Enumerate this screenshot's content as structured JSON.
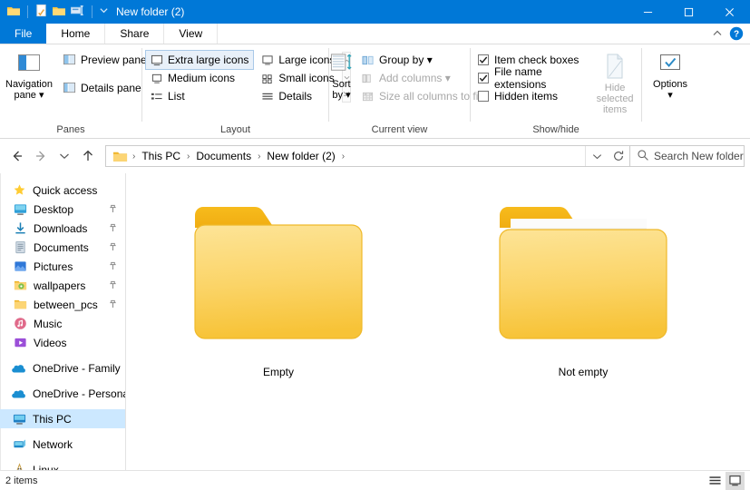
{
  "window": {
    "title": "New folder (2)",
    "titlebar_color": "#0078d7",
    "quick_access_icons": [
      "folder-icon",
      "properties-icon",
      "new-folder-icon",
      "rename-icon",
      "customize-chevron-icon"
    ],
    "minimize_label": "─",
    "maximize_label": "□",
    "close_label": "✕"
  },
  "ribbon": {
    "tabs": [
      {
        "label": "File",
        "kind": "file"
      },
      {
        "label": "Home",
        "kind": "normal"
      },
      {
        "label": "Share",
        "kind": "normal"
      },
      {
        "label": "View",
        "kind": "active"
      }
    ],
    "collapse_icon": "chevron-up-icon",
    "help_icon": "help-circle-icon",
    "help_label": "?",
    "groups": {
      "panes": {
        "label": "Panes",
        "navigation_pane": {
          "label": "Navigation\npane ▾",
          "line1": "Navigation",
          "line2": "pane ▾"
        },
        "items": [
          {
            "label": "Preview pane",
            "icon": "preview-pane-icon"
          },
          {
            "label": "Details pane",
            "icon": "details-pane-icon"
          }
        ]
      },
      "layout": {
        "label": "Layout",
        "items": [
          {
            "label": "Extra large icons",
            "icon": "monitor-icon",
            "selected": true
          },
          {
            "label": "Large icons",
            "icon": "monitor-icon",
            "selected": false
          },
          {
            "label": "Medium icons",
            "icon": "monitor-small-icon",
            "selected": false
          },
          {
            "label": "Small icons",
            "icon": "grid-small-icon",
            "selected": false
          },
          {
            "label": "List",
            "icon": "list-icon",
            "selected": false
          },
          {
            "label": "Details",
            "icon": "details-lines-icon",
            "selected": false
          }
        ],
        "scroll_up_icon": "scroll-up-icon",
        "scroll_down_icon": "scroll-down-icon",
        "scroll_more_icon": "scroll-expand-icon"
      },
      "current_view": {
        "label": "Current view",
        "sort_by": {
          "line1": "Sort",
          "line2": "by ▾",
          "icon": "sort-icon"
        },
        "items": [
          {
            "label": "Group by ▾",
            "icon": "group-by-icon",
            "disabled": false
          },
          {
            "label": "Add columns ▾",
            "icon": "add-columns-icon",
            "disabled": true
          },
          {
            "label": "Size all columns to fit",
            "icon": "fit-columns-icon",
            "disabled": true
          }
        ]
      },
      "show_hide": {
        "label": "Show/hide",
        "checkboxes": [
          {
            "label": "Item check boxes",
            "checked": true
          },
          {
            "label": "File name extensions",
            "checked": true
          },
          {
            "label": "Hidden items",
            "checked": false
          }
        ],
        "hide_selected": {
          "line1": "Hide selected",
          "line2": "items",
          "icon": "hide-items-icon",
          "disabled": true
        }
      },
      "options": {
        "line1": "Options",
        "line2": "▾",
        "icon": "options-check-icon"
      }
    }
  },
  "addressbar": {
    "back_icon": "arrow-left-icon",
    "forward_icon": "arrow-right-icon",
    "recent_icon": "chevron-down-icon",
    "up_icon": "arrow-up-icon",
    "path_icon": "folder-icon",
    "crumbs": [
      "This PC",
      "Documents",
      "New folder (2)"
    ],
    "separator": "›",
    "dropdown_icon": "chevron-down-icon",
    "refresh_icon": "refresh-icon",
    "search": {
      "icon": "search-icon",
      "placeholder": "Search New folder...",
      "value": ""
    }
  },
  "navigation_pane": {
    "items": [
      {
        "label": "Quick access",
        "icon": "star-icon",
        "indent": 0,
        "pinned": false,
        "selected": false
      },
      {
        "label": "Desktop",
        "icon": "desktop-icon",
        "indent": 1,
        "pinned": true,
        "selected": false
      },
      {
        "label": "Downloads",
        "icon": "downloads-icon",
        "indent": 1,
        "pinned": true,
        "selected": false
      },
      {
        "label": "Documents",
        "icon": "documents-icon",
        "indent": 1,
        "pinned": true,
        "selected": false
      },
      {
        "label": "Pictures",
        "icon": "pictures-icon",
        "indent": 1,
        "pinned": true,
        "selected": false
      },
      {
        "label": "wallpapers",
        "icon": "wallpapers-folder-icon",
        "indent": 1,
        "pinned": true,
        "selected": false
      },
      {
        "label": "between_pcs",
        "icon": "folder-icon",
        "indent": 1,
        "pinned": true,
        "selected": false
      },
      {
        "label": "Music",
        "icon": "music-icon",
        "indent": 1,
        "pinned": false,
        "selected": false
      },
      {
        "label": "Videos",
        "icon": "videos-icon",
        "indent": 1,
        "pinned": false,
        "selected": false
      },
      {
        "label": "OneDrive - Family",
        "icon": "onedrive-icon",
        "indent": 0,
        "pinned": false,
        "selected": false,
        "gap_before": true
      },
      {
        "label": "OneDrive - Personal",
        "icon": "onedrive-icon",
        "indent": 0,
        "pinned": false,
        "selected": false,
        "gap_before": true
      },
      {
        "label": "This PC",
        "icon": "this-pc-icon",
        "indent": 0,
        "pinned": false,
        "selected": true,
        "gap_before": true
      },
      {
        "label": "Network",
        "icon": "network-icon",
        "indent": 0,
        "pinned": false,
        "selected": false,
        "gap_before": true
      },
      {
        "label": "Linux",
        "icon": "linux-icon",
        "indent": 0,
        "pinned": false,
        "selected": false,
        "gap_before": true
      }
    ]
  },
  "content": {
    "items": [
      {
        "name": "Empty",
        "type": "folder",
        "has_contents": false
      },
      {
        "name": "Not empty",
        "type": "folder",
        "has_contents": true
      }
    ],
    "folder_colors": {
      "tab": "#f5b817",
      "front_top": "#fcdf7c",
      "front_bottom": "#f8c43b",
      "paper": "#f1f1f1"
    }
  },
  "statusbar": {
    "item_count": "2 items",
    "views": [
      {
        "icon": "details-view-icon",
        "active": false
      },
      {
        "icon": "large-icons-view-icon",
        "active": true
      }
    ]
  }
}
